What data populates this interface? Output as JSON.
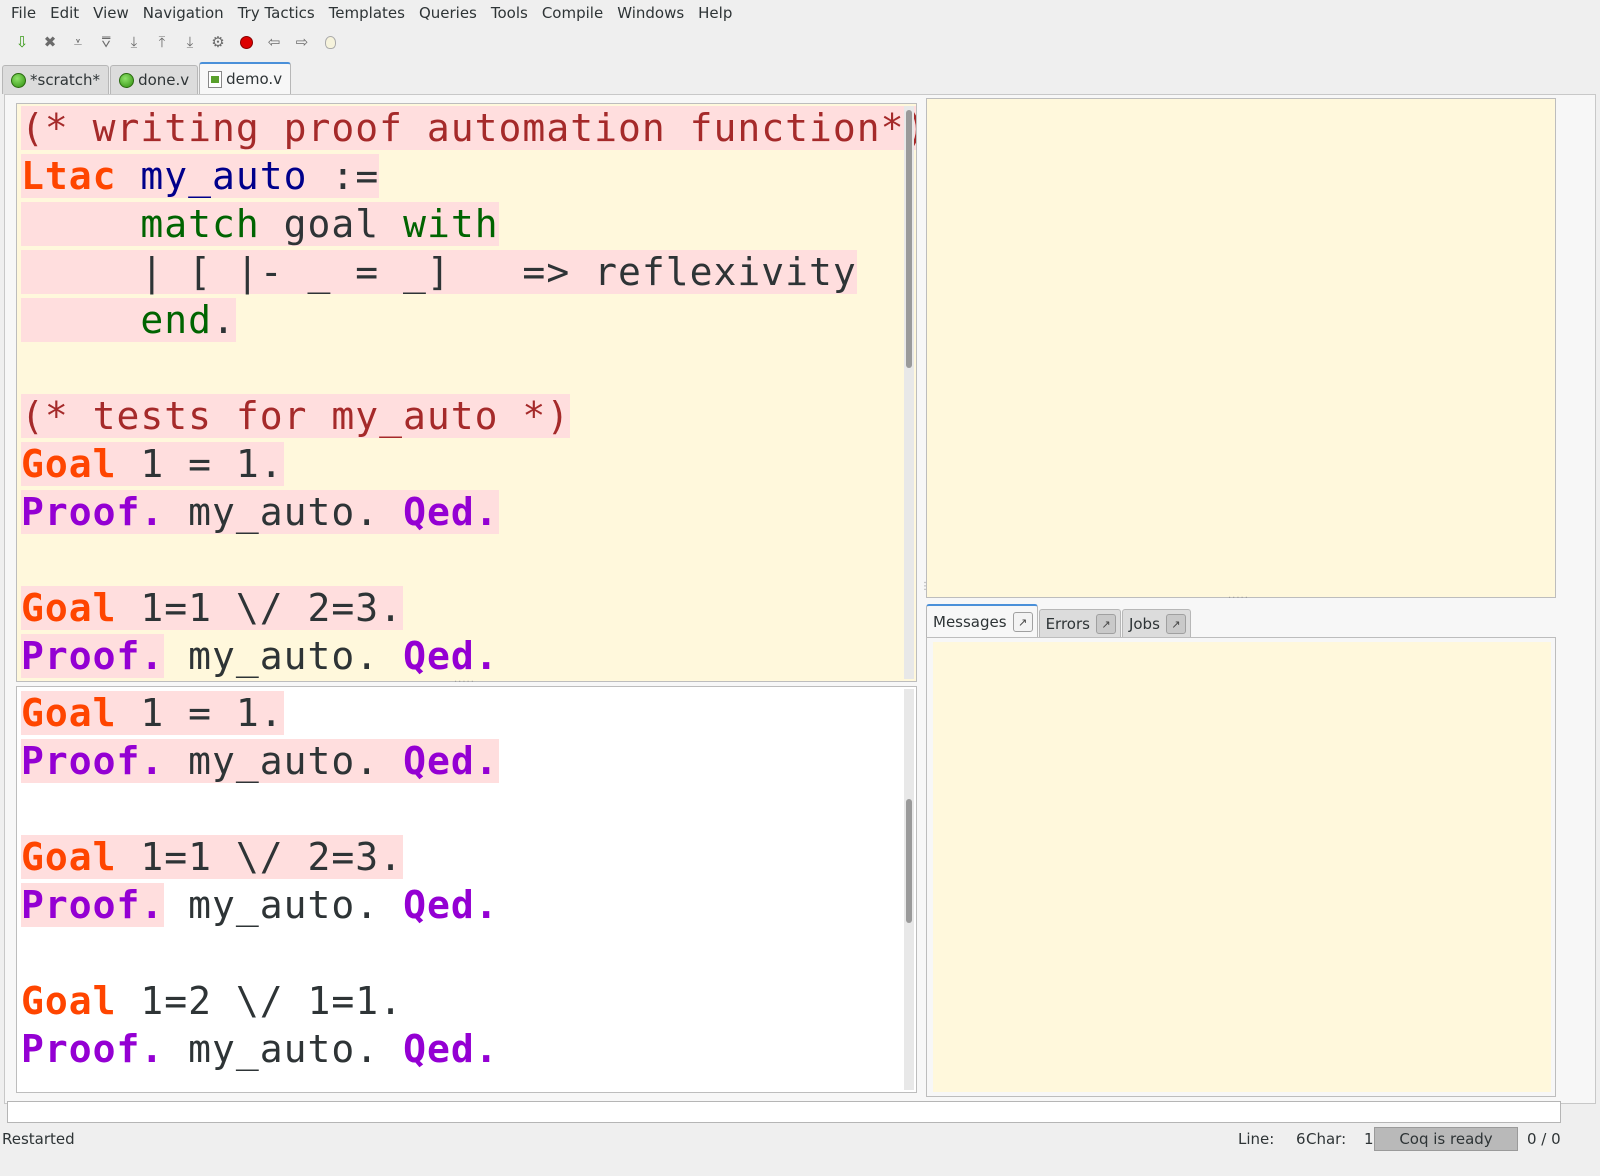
{
  "menu": [
    "File",
    "Edit",
    "View",
    "Navigation",
    "Try Tactics",
    "Templates",
    "Queries",
    "Tools",
    "Compile",
    "Windows",
    "Help"
  ],
  "toolbar": [
    {
      "icon": "save-icon",
      "glyph": "⇩"
    },
    {
      "icon": "close-icon",
      "glyph": "✖"
    },
    {
      "icon": "forward-one-icon",
      "glyph": "⩡"
    },
    {
      "icon": "backward-one-icon",
      "glyph": "⩢"
    },
    {
      "icon": "go-to-cursor-icon",
      "glyph": "⤓"
    },
    {
      "icon": "restart-icon",
      "glyph": "⤒"
    },
    {
      "icon": "go-to-end-icon",
      "glyph": "⤓"
    },
    {
      "icon": "fully-check-icon",
      "glyph": "⚙"
    },
    {
      "icon": "interrupt-icon",
      "glyph": ""
    },
    {
      "icon": "previous-occurrence-icon",
      "glyph": "⇦"
    },
    {
      "icon": "next-occurrence-icon",
      "glyph": "⇨"
    },
    {
      "icon": "hint-icon",
      "glyph": ""
    }
  ],
  "tabs": [
    {
      "label": "*scratch*",
      "icon": "status-ok-icon"
    },
    {
      "label": "done.v",
      "icon": "status-ok-icon"
    },
    {
      "label": "demo.v",
      "icon": "file-saved-icon"
    }
  ],
  "script_top": [
    [
      [
        "(* writing proof automation function*)",
        "c-comment",
        true
      ]
    ],
    [
      [
        "Ltac",
        "c-vernac",
        true
      ],
      [
        " ",
        "c-plain",
        true
      ],
      [
        "my_auto",
        "c-ident",
        true
      ],
      [
        " :=",
        "c-plain",
        true
      ]
    ],
    [
      [
        "     ",
        "c-plain",
        true
      ],
      [
        "match",
        "c-tactic",
        true
      ],
      [
        " goal ",
        "c-plain",
        true
      ],
      [
        "with",
        "c-tactic",
        true
      ]
    ],
    [
      [
        "     | [ |- _ = _]   => reflexivity",
        "c-plain",
        true
      ]
    ],
    [
      [
        "     ",
        "c-plain",
        true
      ],
      [
        "end",
        "c-tactic",
        true
      ],
      [
        ".",
        "c-plain",
        true
      ]
    ],
    [],
    [
      [
        "(* tests for my_auto *)",
        "c-comment",
        true
      ]
    ],
    [
      [
        "Goal",
        "c-vernac",
        true
      ],
      [
        " 1 = 1.",
        "c-plain",
        true
      ]
    ],
    [
      [
        "Proof.",
        "c-proof",
        true
      ],
      [
        " my_auto. ",
        "c-plain",
        true
      ],
      [
        "Qed.",
        "c-proof",
        true
      ]
    ],
    [],
    [
      [
        "Goal",
        "c-vernac",
        true
      ],
      [
        " 1=1 \\/ 2=3.",
        "c-plain",
        true
      ]
    ],
    [
      [
        "Proof.",
        "c-proof",
        true
      ],
      [
        " my_auto. ",
        "c-plain",
        false
      ],
      [
        "Qed.",
        "c-proof",
        false
      ]
    ]
  ],
  "script_bottom": [
    [
      [
        "Goal",
        "c-vernac",
        true
      ],
      [
        " 1 = 1.",
        "c-plain",
        true
      ]
    ],
    [
      [
        "Proof.",
        "c-proof",
        true
      ],
      [
        " my_auto. ",
        "c-plain",
        true
      ],
      [
        "Qed.",
        "c-proof",
        true
      ]
    ],
    [],
    [
      [
        "Goal",
        "c-vernac",
        true
      ],
      [
        " 1=1 \\/ 2=3.",
        "c-plain",
        true
      ]
    ],
    [
      [
        "Proof.",
        "c-proof",
        true
      ],
      [
        " my_auto. ",
        "c-plain",
        false
      ],
      [
        "Qed.",
        "c-proof",
        false
      ]
    ],
    [],
    [
      [
        "Goal",
        "c-vernac",
        false
      ],
      [
        " 1=2 \\/ 1=1.",
        "c-plain",
        false
      ]
    ],
    [
      [
        "Proof.",
        "c-proof",
        false
      ],
      [
        " my_auto. ",
        "c-plain",
        false
      ],
      [
        "Qed.",
        "c-proof",
        false
      ]
    ]
  ],
  "message_tabs": [
    {
      "label": "Messages",
      "detach": "↗"
    },
    {
      "label": "Errors",
      "detach": "↗"
    },
    {
      "label": "Jobs",
      "detach": "↗"
    }
  ],
  "status": {
    "text": "Restarted",
    "line_label": "Line:",
    "line_value": "6",
    "char_label": "Char:",
    "char_value": "1",
    "coq_status": "Coq is ready",
    "count": "0 / 0"
  },
  "colors": {
    "processed_bg": "#ffdede",
    "editor_bg": "#fff8dc",
    "comment": "#a52a2a",
    "vernacular": "#ff4500",
    "proof_keyword": "#9400d3",
    "tactic": "#006400",
    "identifier": "#00008b"
  }
}
